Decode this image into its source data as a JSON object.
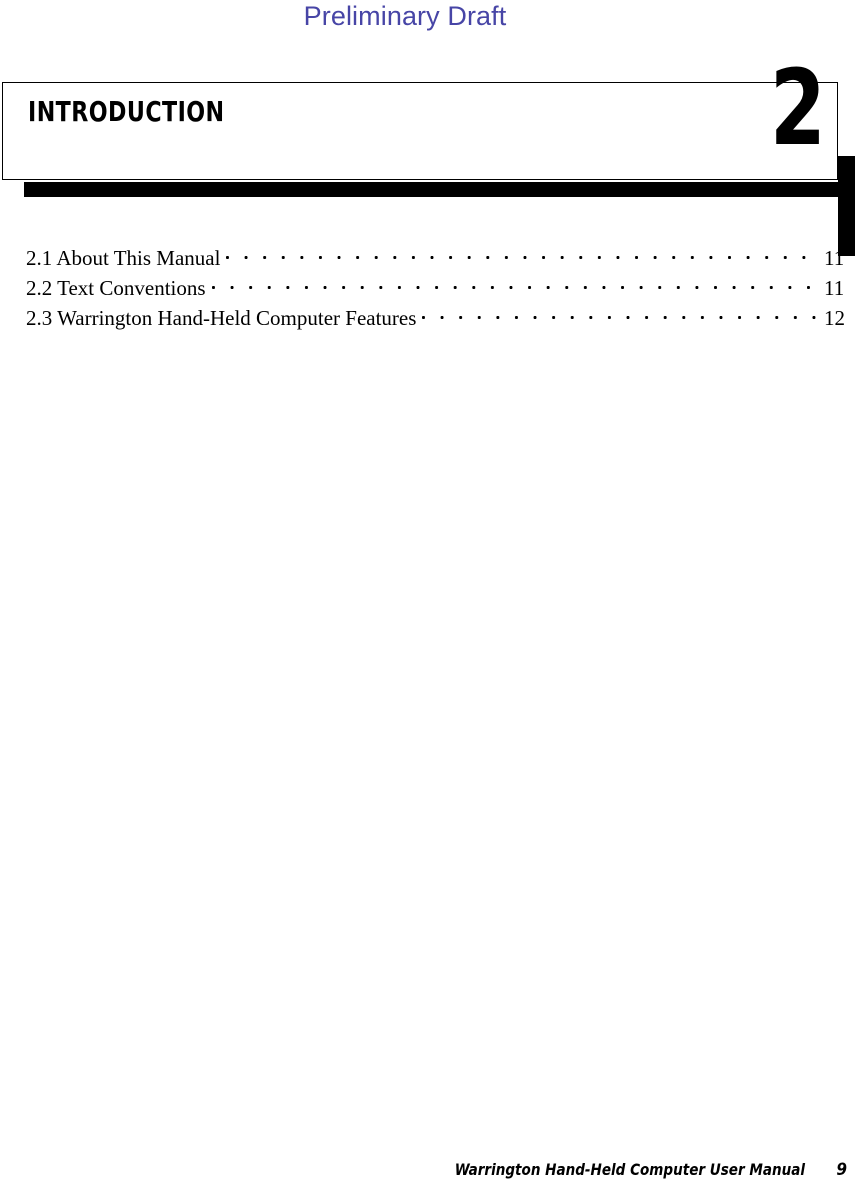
{
  "page": {
    "watermark": "Preliminary Draft",
    "watermark_color": "#4745a6",
    "background_color": "#ffffff",
    "text_color": "#000000"
  },
  "chapter": {
    "title": "Introduction",
    "number": "2",
    "accent_color": "#000000"
  },
  "toc": {
    "entries": [
      {
        "label": "2.1 About This Manual",
        "page": "11"
      },
      {
        "label": "2.2 Text Conventions",
        "page": "11"
      },
      {
        "label": "2.3 Warrington Hand-Held Computer Features",
        "page": "12"
      }
    ]
  },
  "footer": {
    "title": "Warrington Hand-Held Computer User Manual",
    "page_number": "9"
  }
}
